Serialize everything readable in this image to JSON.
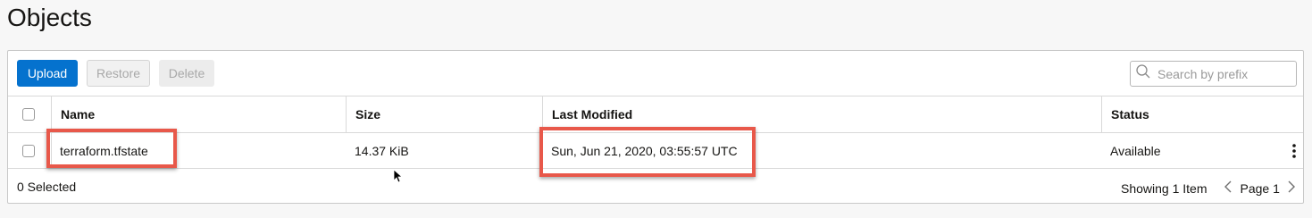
{
  "page": {
    "title": "Objects"
  },
  "toolbar": {
    "upload_label": "Upload",
    "restore_label": "Restore",
    "delete_label": "Delete",
    "search_placeholder": "Search by prefix"
  },
  "table": {
    "columns": [
      "Name",
      "Size",
      "Last Modified",
      "Status"
    ],
    "rows": [
      {
        "name": "terraform.tfstate",
        "size": "14.37 KiB",
        "modified": "Sun, Jun 21, 2020, 03:55:57 UTC",
        "status": "Available"
      }
    ]
  },
  "footer": {
    "selected": "0 Selected",
    "showing": "Showing 1 Item",
    "page": "Page 1"
  },
  "colors": {
    "primary": "#0572ce",
    "highlight": "#e8584a"
  },
  "icons": [
    "search-icon",
    "kebab-menu-icon",
    "chevron-left-icon",
    "chevron-right-icon",
    "mouse-cursor-icon"
  ]
}
